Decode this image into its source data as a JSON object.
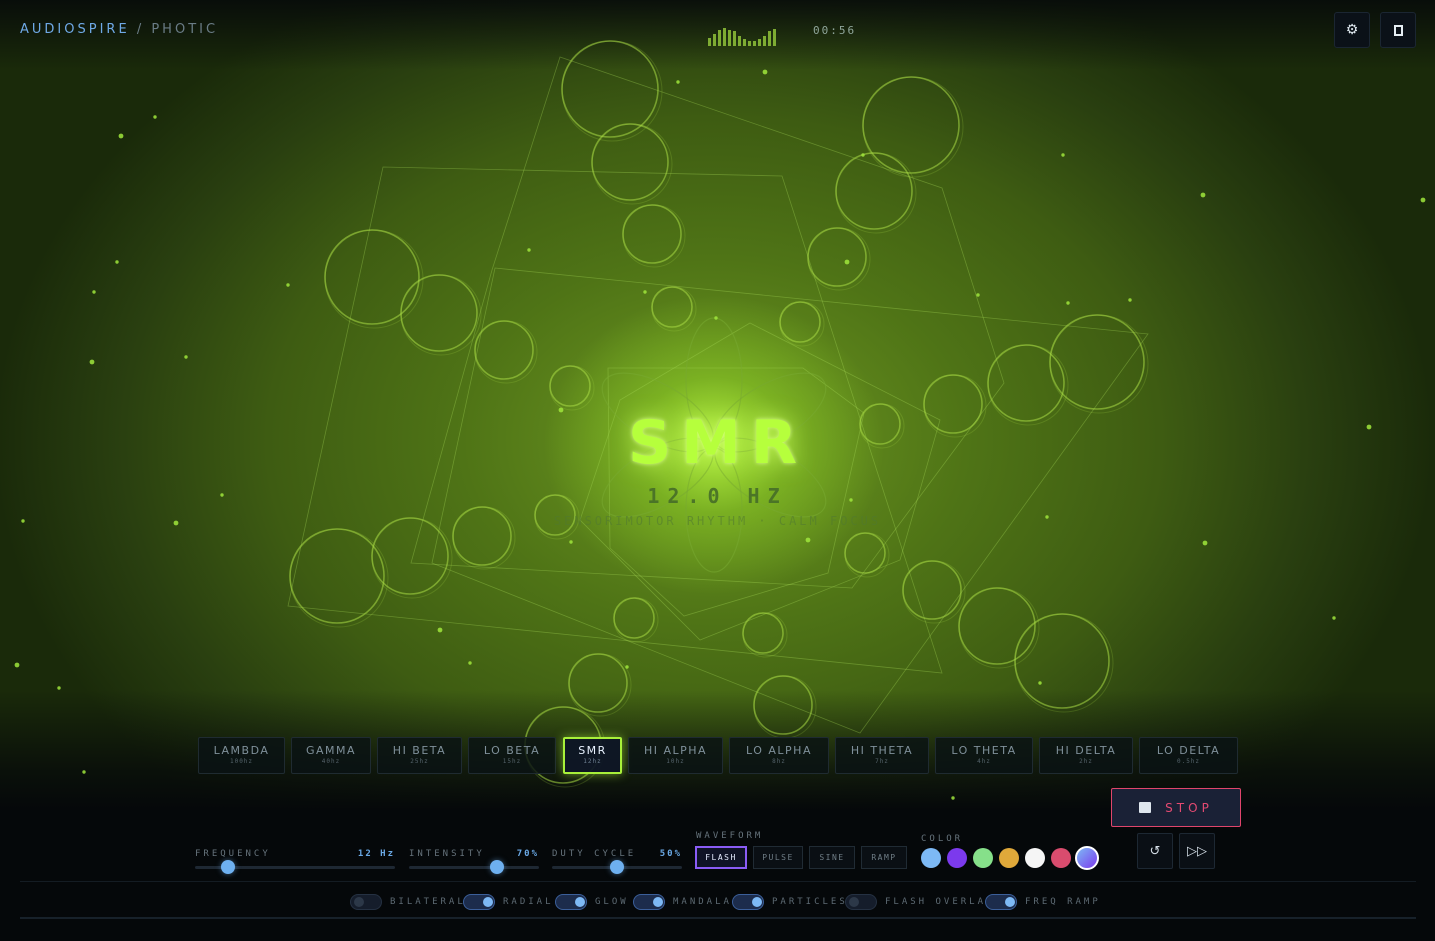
{
  "header": {
    "brand": "AUDIOSPIRE",
    "separator": "/",
    "mode": "PHOTIC",
    "clock": "00:56",
    "meter_levels": [
      0.35,
      0.55,
      0.75,
      0.9,
      0.8,
      0.7,
      0.45,
      0.3,
      0.15,
      0.15,
      0.25,
      0.45,
      0.7,
      0.85
    ],
    "settings_icon": "gear-icon",
    "fullscreen_icon": "fullscreen-icon"
  },
  "display": {
    "title": "SMR",
    "frequency": "12.0 HZ",
    "subtitle": "SENSORIMOTOR RHYTHM · CALM FOCUS",
    "accent_color": "#b6ff3c"
  },
  "bands": [
    {
      "name": "LAMBDA",
      "hz": "100hz"
    },
    {
      "name": "GAMMA",
      "hz": "40hz"
    },
    {
      "name": "HI BETA",
      "hz": "25hz"
    },
    {
      "name": "LO BETA",
      "hz": "15hz"
    },
    {
      "name": "SMR",
      "hz": "12hz"
    },
    {
      "name": "HI ALPHA",
      "hz": "10hz"
    },
    {
      "name": "LO ALPHA",
      "hz": "8hz"
    },
    {
      "name": "HI THETA",
      "hz": "7hz"
    },
    {
      "name": "LO THETA",
      "hz": "4hz"
    },
    {
      "name": "HI DELTA",
      "hz": "2hz"
    },
    {
      "name": "LO DELTA",
      "hz": "0.5hz"
    }
  ],
  "active_band": "SMR",
  "transport": {
    "stop_label": "STOP",
    "stop_icon": "stop-icon",
    "reset_icon": "reset-icon",
    "skip_icon": "skip-icon",
    "reset_glyph": "↺",
    "skip_glyph": "▷▷"
  },
  "controls": {
    "frequency": {
      "label": "FREQUENCY",
      "value": "12 Hz",
      "level": 0.14
    },
    "intensity": {
      "label": "INTENSITY",
      "value": "70%",
      "level": 0.7
    },
    "duty_cycle": {
      "label": "DUTY CYCLE",
      "value": "50%",
      "level": 0.5
    }
  },
  "waveform": {
    "label": "WAVEFORM",
    "options": [
      "FLASH",
      "PULSE",
      "SINE",
      "RAMP"
    ],
    "selected": "FLASH"
  },
  "color": {
    "label": "COLOR",
    "swatches": [
      "#7db9f5",
      "#7c3aed",
      "#86e08a",
      "#e0a93a",
      "#f5f5f5",
      "#d94c6e",
      "#6a7cf6"
    ],
    "selected_index": 6
  },
  "toggles": [
    {
      "label": "BILATERAL",
      "on": false
    },
    {
      "label": "RADIAL",
      "on": true
    },
    {
      "label": "GLOW",
      "on": true
    },
    {
      "label": "MANDALA",
      "on": true
    },
    {
      "label": "PARTICLES",
      "on": true
    },
    {
      "label": "FLASH OVERLAY",
      "on": false
    },
    {
      "label": "FREQ RAMP",
      "on": true
    }
  ]
}
